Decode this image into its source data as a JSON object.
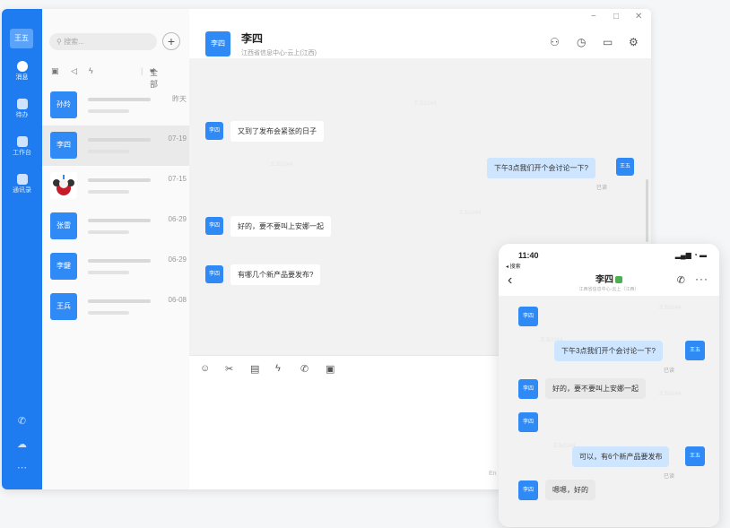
{
  "user": {
    "avatar_label": "王五"
  },
  "rail": {
    "items": [
      {
        "label": "消息",
        "icon": "message-icon"
      },
      {
        "label": "待办",
        "icon": "todo-icon"
      },
      {
        "label": "工作台",
        "icon": "workbench-icon"
      },
      {
        "label": "通讯录",
        "icon": "contacts-icon"
      }
    ],
    "bottom_icons": [
      "phone-icon",
      "cloud-icon",
      "more-icon"
    ]
  },
  "conversations": {
    "search_placeholder": "搜索...",
    "add_label": "+",
    "filter_label": "全部",
    "items": [
      {
        "avatar": "孙羚",
        "time": "昨天"
      },
      {
        "avatar": "李四",
        "time": "07-19"
      },
      {
        "avatar": "",
        "time": "07-15"
      },
      {
        "avatar": "张雷",
        "time": "06-29"
      },
      {
        "avatar": "李鍵",
        "time": "06-29"
      },
      {
        "avatar": "王兵",
        "time": "06-08"
      }
    ]
  },
  "chat": {
    "window_controls": [
      "−",
      "□",
      "✕"
    ],
    "title": "李四",
    "subtitle": "江西省信息中心-云上(江西)",
    "peer_avatar": "李四",
    "self_avatar": "王五",
    "messages": [
      {
        "from": "peer",
        "text": "又到了发布会紧张的日子"
      },
      {
        "from": "self",
        "text": "下午3点我们开个会讨论一下?",
        "status": "已读"
      },
      {
        "from": "peer",
        "text": "好的，要不要叫上安娜一起"
      },
      {
        "from": "peer",
        "text": "有哪几个新产品要发布?"
      }
    ],
    "watermark": "王五0244",
    "send_hint": "En"
  },
  "phone": {
    "time": "11:40",
    "back_label": "◂ 搜索",
    "title": "李四",
    "subtitle": "江西省信息中心-云上（江西）",
    "messages": [
      {
        "from": "peer",
        "text": ""
      },
      {
        "from": "self",
        "text": "下午3点我们开个会讨论一下?",
        "status": "已读"
      },
      {
        "from": "peer",
        "text": "好的，要不要叫上安娜一起"
      },
      {
        "from": "peer",
        "text": ""
      },
      {
        "from": "self",
        "text": "可以，有6个新产品要发布",
        "status": "已读"
      },
      {
        "from": "peer",
        "text": "嗯嗯，好的"
      }
    ]
  },
  "colors": {
    "accent": "#1e7cf0",
    "bubble_out": "#cde5ff"
  }
}
